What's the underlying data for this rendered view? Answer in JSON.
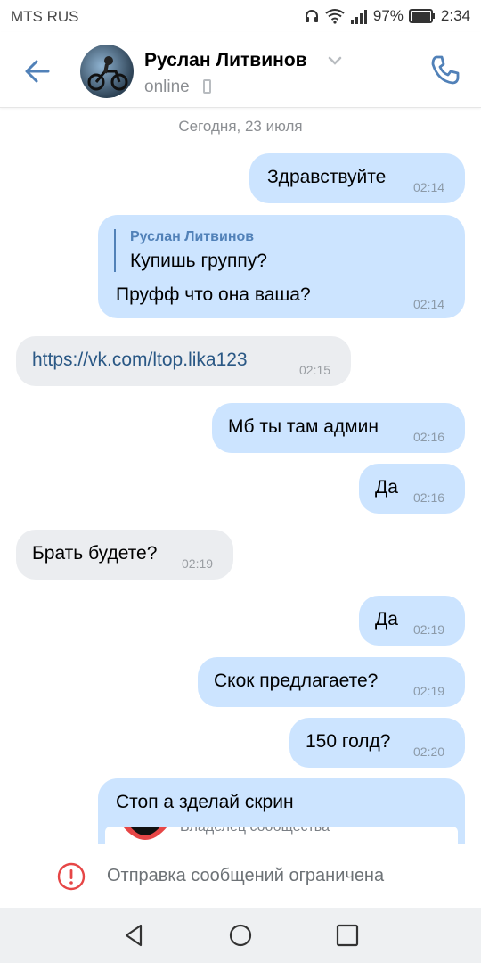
{
  "status_bar": {
    "carrier": "MTS RUS",
    "battery": "97%",
    "time": "2:34"
  },
  "header": {
    "contact_name": "Руслан Литвинов",
    "presence": "online"
  },
  "chat": {
    "date_separator": "Сегодня, 23 июля",
    "messages": [
      {
        "dir": "out",
        "text": "Здравствуйте",
        "time": "02:14"
      },
      {
        "dir": "out",
        "reply_to_name": "Руслан Литвинов",
        "reply_to_text": "Купишь группу?",
        "text": "Пруфф что она ваша?",
        "time": "02:14"
      },
      {
        "dir": "in",
        "text": "https://vk.com/ltop.lika123",
        "time": "02:15"
      },
      {
        "dir": "out",
        "text": "Мб ты там админ",
        "time": "02:16"
      },
      {
        "dir": "out",
        "text": "Да",
        "time": "02:16"
      },
      {
        "dir": "in",
        "text": "Брать будете?",
        "time": "02:19"
      },
      {
        "dir": "out",
        "text": "Да",
        "time": "02:19"
      },
      {
        "dir": "out",
        "text": "Скок предлагаете?",
        "time": "02:19"
      },
      {
        "dir": "out",
        "text": "150 голд?",
        "time": "02:20"
      },
      {
        "dir": "out",
        "text": "Стоп а зделай скрин",
        "attachment_caption": "Владелец сообщества"
      }
    ]
  },
  "footer": {
    "restriction_text": "Отправка сообщений ограничена"
  },
  "colors": {
    "accent": "#5181b8",
    "outgoing_bubble": "#cce4ff",
    "incoming_bubble": "#ebedf0",
    "warning": "#e64646"
  },
  "icons": {
    "back": "arrow-left-icon",
    "call": "phone-icon",
    "warning": "exclamation-circle-icon"
  }
}
